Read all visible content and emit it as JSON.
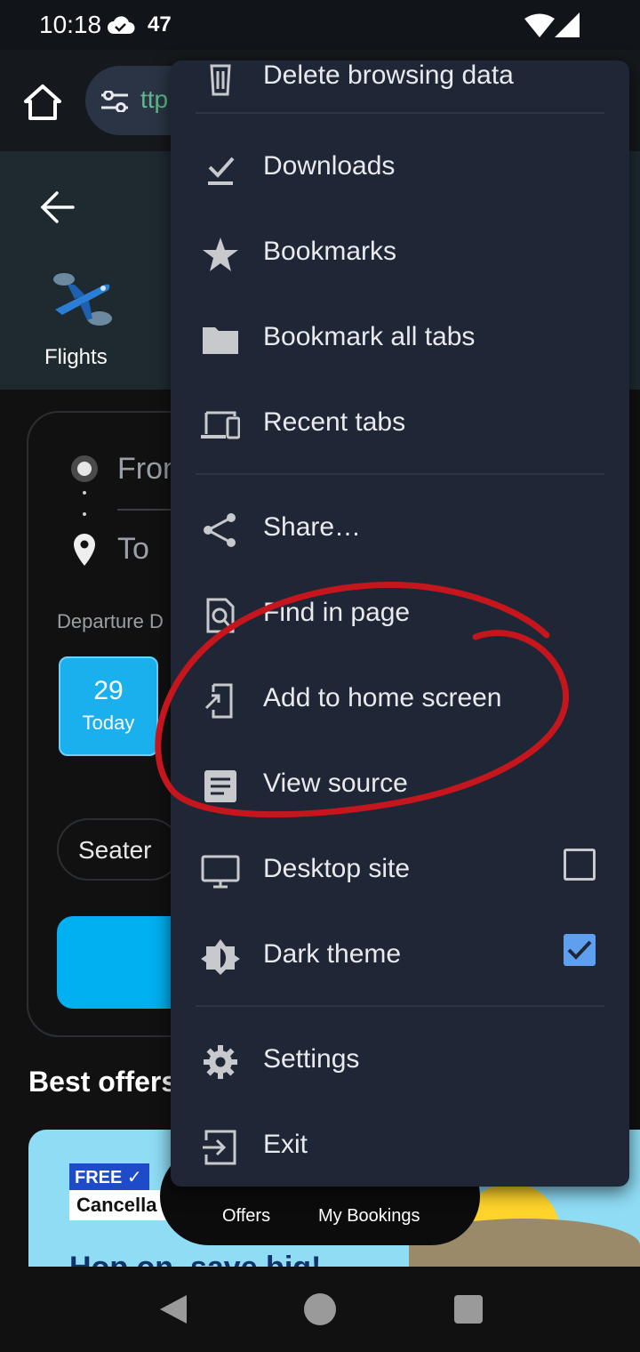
{
  "status_bar": {
    "time": "10:18",
    "notification_count": "47"
  },
  "browser": {
    "url_fragment": "ttp"
  },
  "page": {
    "category_label": "Flights",
    "from_placeholder": "Fron",
    "to_placeholder": "To",
    "departure_label": "Departure D",
    "date_chip": {
      "day_number": "29",
      "day_label": "Today"
    },
    "seat_chip": "Seater",
    "best_offers_heading": "Best offers",
    "offer_badge_free": "FREE",
    "offer_badge_cancel": "Cancella",
    "offer_heading": "Hop on, save big!"
  },
  "bottom_nav": {
    "offers": "Offers",
    "my_bookings": "My Bookings"
  },
  "menu": {
    "items": [
      {
        "label": "Delete browsing data",
        "icon": "trash-icon"
      },
      {
        "label": "Downloads",
        "icon": "download-done-icon"
      },
      {
        "label": "Bookmarks",
        "icon": "star-icon"
      },
      {
        "label": "Bookmark all tabs",
        "icon": "folder-icon"
      },
      {
        "label": "Recent tabs",
        "icon": "devices-icon"
      },
      {
        "label": "Share…",
        "icon": "share-icon"
      },
      {
        "label": "Find in page",
        "icon": "find-in-page-icon"
      },
      {
        "label": "Add to home screen",
        "icon": "add-to-home-icon"
      },
      {
        "label": "View source",
        "icon": "article-icon"
      },
      {
        "label": "Desktop site",
        "icon": "desktop-icon",
        "checked": false
      },
      {
        "label": "Dark theme",
        "icon": "brightness-icon",
        "checked": true
      },
      {
        "label": "Settings",
        "icon": "gear-icon"
      },
      {
        "label": "Exit",
        "icon": "exit-icon"
      }
    ]
  },
  "colors": {
    "menu_bg": "#1f2636",
    "accent_blue": "#00b0f0",
    "checkbox_on": "#5ea0ef",
    "annotation_red": "#c4161c"
  }
}
